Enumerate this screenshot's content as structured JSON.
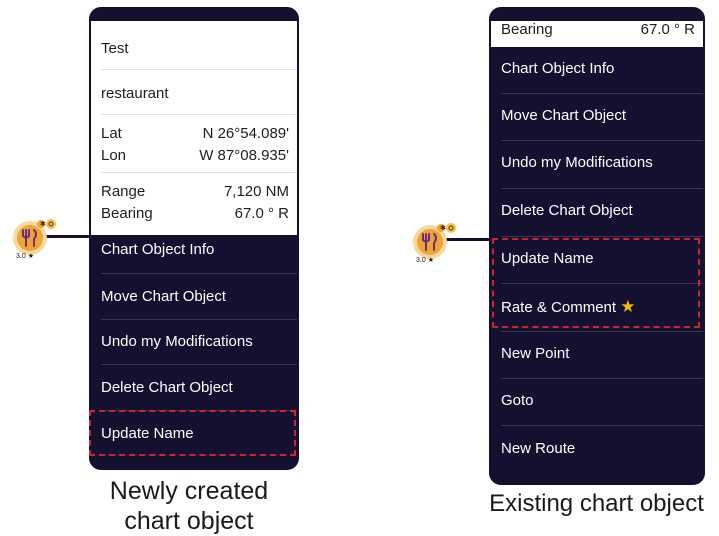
{
  "left_popup": {
    "name": "Test",
    "type": "restaurant",
    "lat_label": "Lat",
    "lat_value": "N 26°54.089'",
    "lon_label": "Lon",
    "lon_value": "W 87°08.935'",
    "range_label": "Range",
    "range_value": "7,120 NM",
    "bearing_label": "Bearing",
    "bearing_value": "67.0 ° R",
    "menu": [
      "Chart Object Info",
      "Move Chart Object",
      "Undo my Modifications",
      "Delete Chart Object",
      "Update Name"
    ],
    "caption_line1": "Newly created",
    "caption_line2": "chart object"
  },
  "right_popup": {
    "bearing_label": "Bearing",
    "bearing_value": "67.0 ° R",
    "menu": [
      "Chart Object Info",
      "Move Chart Object",
      "Undo my Modifications",
      "Delete Chart Object",
      "Update Name",
      "Rate & Comment",
      "New Point",
      "Goto",
      "New Route"
    ],
    "caption": "Existing chart object"
  },
  "marker": {
    "rating": "3.0",
    "icon": "fork-knife-icon"
  },
  "colors": {
    "panel": "#141030",
    "highlight": "#d2232a",
    "marker": "#f0a530",
    "star": "#f5b800"
  }
}
